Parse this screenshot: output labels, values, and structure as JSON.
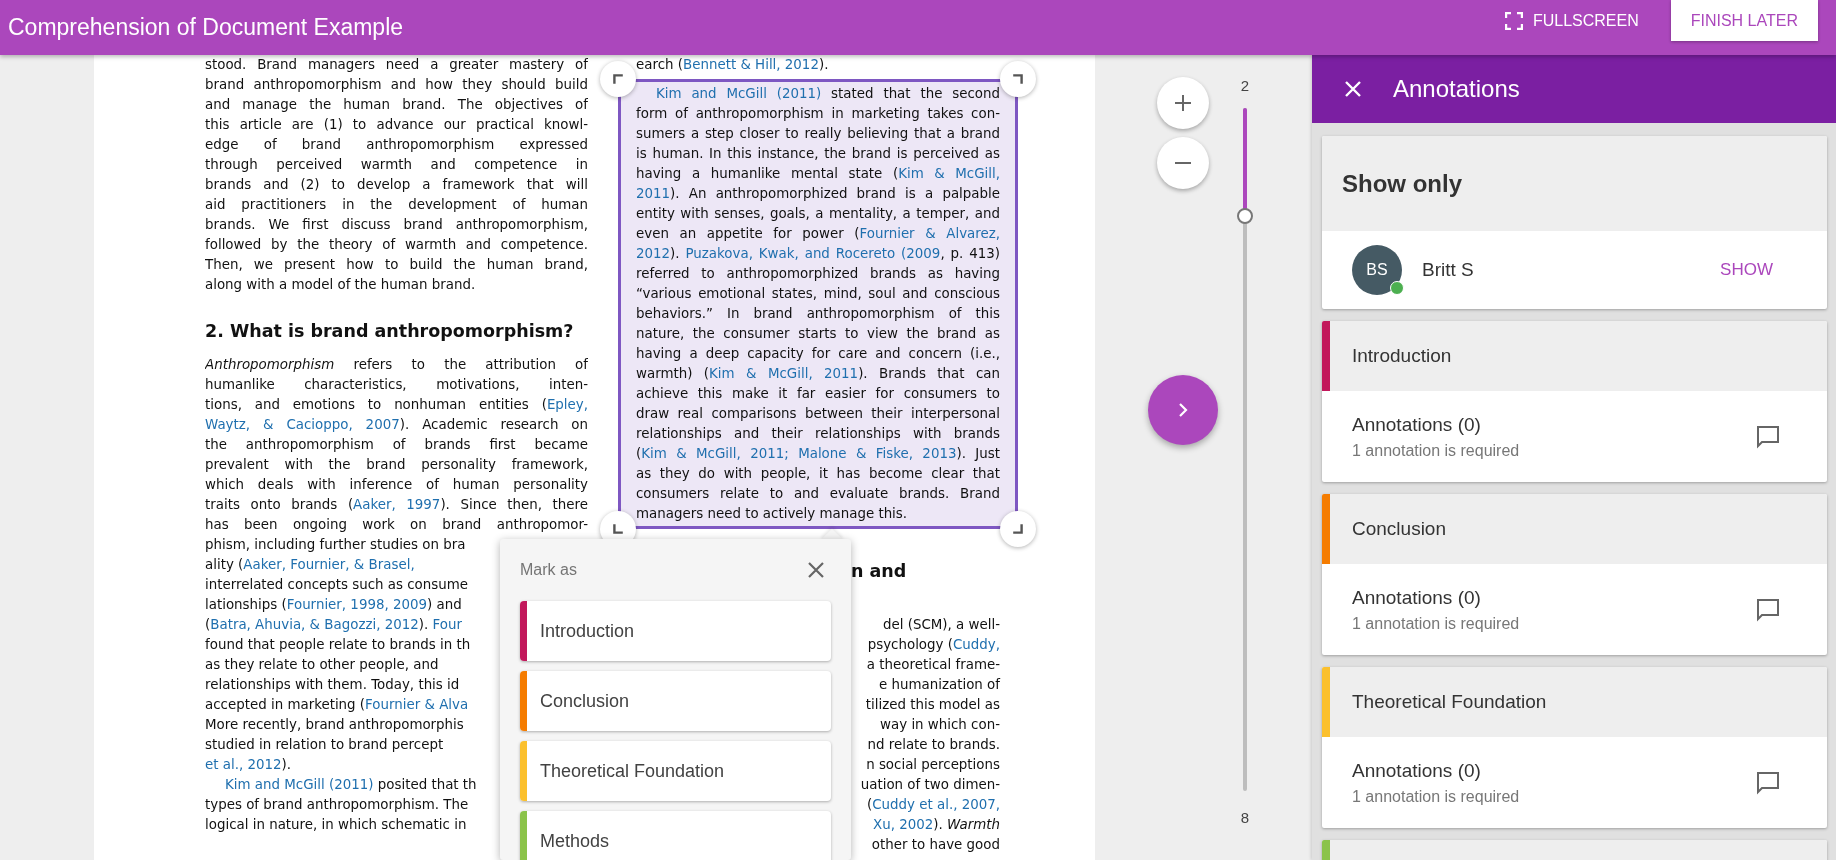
{
  "app_bar": {
    "title": "Comprehension of Document Example",
    "fullscreen_label": "FULLSCREEN",
    "finish_label": "FINISH LATER"
  },
  "document": {
    "columns": [
      {
        "blocks": [
          {
            "kind": "para",
            "lines": [
              {
                "kind": "justify",
                "parts": [
                  {
                    "text": "stood. Brand managers need a greater mastery of"
                  }
                ]
              },
              {
                "kind": "justify",
                "parts": [
                  {
                    "text": "brand anthropomorphism and how they should build"
                  }
                ]
              },
              {
                "kind": "justify",
                "parts": [
                  {
                    "text": "and manage the human brand. The objectives of"
                  }
                ]
              },
              {
                "kind": "justify",
                "parts": [
                  {
                    "text": "this article are (1) to advance our practical knowl-"
                  }
                ]
              },
              {
                "kind": "justify",
                "parts": [
                  {
                    "text": "edge of brand anthropomorphism expressed"
                  }
                ]
              },
              {
                "kind": "justify",
                "parts": [
                  {
                    "text": "through perceived warmth and competence in"
                  }
                ]
              },
              {
                "kind": "justify",
                "parts": [
                  {
                    "text": "brands and (2) to develop a framework that will"
                  }
                ]
              },
              {
                "kind": "justify",
                "parts": [
                  {
                    "text": "aid practitioners in the development of human"
                  }
                ]
              },
              {
                "kind": "justify",
                "parts": [
                  {
                    "text": "brands. We first discuss brand anthropomorphism,"
                  }
                ]
              },
              {
                "kind": "justify",
                "parts": [
                  {
                    "text": "followed by the theory of warmth and competence."
                  }
                ]
              },
              {
                "kind": "justify",
                "parts": [
                  {
                    "text": "Then, we present how to build the human brand,"
                  }
                ]
              },
              {
                "kind": "left",
                "parts": [
                  {
                    "text": "along with a model of the human brand."
                  }
                ]
              }
            ]
          },
          {
            "kind": "heading",
            "lines": [
              {
                "kind": "left",
                "parts": [
                  {
                    "text": "2.  What is brand anthropomorphism?"
                  }
                ]
              }
            ]
          },
          {
            "kind": "para",
            "lines": [
              {
                "kind": "justify",
                "parts": [
                  {
                    "text": "*Anthropomorphism* refers to the attribution of"
                  }
                ]
              },
              {
                "kind": "justify",
                "parts": [
                  {
                    "text": "humanlike characteristics, motivations, inten-"
                  }
                ]
              },
              {
                "kind": "justify",
                "parts": [
                  {
                    "text": "tions, and emotions to nonhuman entities ("
                  },
                  {
                    "text": "Epley,",
                    "cite": true
                  }
                ]
              },
              {
                "kind": "justify",
                "parts": [
                  {
                    "text": "Waytz, & Cacioppo, 2007",
                    "cite": true
                  },
                  {
                    "text": "). Academic research on"
                  }
                ]
              },
              {
                "kind": "justify",
                "parts": [
                  {
                    "text": "the anthropomorphism of brands first became"
                  }
                ]
              },
              {
                "kind": "justify",
                "parts": [
                  {
                    "text": "prevalent with the brand personality framework,"
                  }
                ]
              },
              {
                "kind": "justify",
                "parts": [
                  {
                    "text": "which deals with inference of human personality"
                  }
                ]
              },
              {
                "kind": "justify",
                "parts": [
                  {
                    "text": "traits onto brands ("
                  },
                  {
                    "text": "Aaker, 1997",
                    "cite": true
                  },
                  {
                    "text": "). Since then, there"
                  }
                ]
              },
              {
                "kind": "justify",
                "parts": [
                  {
                    "text": "has been ongoing work on brand anthropomor-"
                  }
                ]
              },
              {
                "kind": "left",
                "parts": [
                  {
                    "text": "phism, including further studies on bra"
                  }
                ]
              },
              {
                "kind": "left",
                "parts": [
                  {
                    "text": "ality ("
                  },
                  {
                    "text": "Aaker, Fournier, & Brasel,",
                    "cite": true
                  }
                ]
              },
              {
                "kind": "left",
                "parts": [
                  {
                    "text": "interrelated concepts such as consume"
                  }
                ]
              },
              {
                "kind": "left",
                "parts": [
                  {
                    "text": "lationships ("
                  },
                  {
                    "text": "Fournier, 1998, 2009",
                    "cite": true
                  },
                  {
                    "text": ") and"
                  }
                ]
              },
              {
                "kind": "left",
                "parts": [
                  {
                    "text": "("
                  },
                  {
                    "text": "Batra, Ahuvia, & Bagozzi, 2012",
                    "cite": true
                  },
                  {
                    "text": "). "
                  },
                  {
                    "text": "Four",
                    "cite": true
                  }
                ]
              },
              {
                "kind": "left",
                "parts": [
                  {
                    "text": "found that people relate to brands in th"
                  }
                ]
              },
              {
                "kind": "left",
                "parts": [
                  {
                    "text": "as they relate to other people, and"
                  }
                ]
              },
              {
                "kind": "left",
                "parts": [
                  {
                    "text": "relationships with them. Today, this id"
                  }
                ]
              },
              {
                "kind": "left",
                "parts": [
                  {
                    "text": "accepted in marketing ("
                  },
                  {
                    "text": "Fournier & Alva",
                    "cite": true
                  }
                ]
              },
              {
                "kind": "left",
                "parts": [
                  {
                    "text": "More recently, brand anthropomorphis"
                  }
                ]
              },
              {
                "kind": "left",
                "parts": [
                  {
                    "text": "studied in relation to brand percept"
                  }
                ]
              },
              {
                "kind": "left",
                "parts": [
                  {
                    "text": "et al., 2012",
                    "cite": true
                  },
                  {
                    "text": ")."
                  }
                ]
              },
              {
                "kind": "indent",
                "parts": [
                  {
                    "text": "Kim and McGill (2011)",
                    "cite": true
                  },
                  {
                    "text": " posited that th"
                  }
                ]
              },
              {
                "kind": "left",
                "parts": [
                  {
                    "text": "types of brand anthropomorphism. The"
                  }
                ]
              },
              {
                "kind": "left",
                "parts": [
                  {
                    "text": "logical in nature, in which schematic in"
                  }
                ]
              }
            ]
          }
        ]
      },
      {
        "blocks": [
          {
            "kind": "para",
            "lines": [
              {
                "kind": "left",
                "parts": [
                  {
                    "text": "earch ("
                  },
                  {
                    "text": "Bennett & Hill, 2012",
                    "cite": true
                  },
                  {
                    "text": ")."
                  }
                ]
              }
            ]
          },
          {
            "kind": "selection",
            "lines": [
              {
                "kind": "indent-justify",
                "parts": [
                  {
                    "text": "Kim and McGill (2011)",
                    "cite": true
                  },
                  {
                    "text": " stated that the second"
                  }
                ]
              },
              {
                "kind": "justify",
                "parts": [
                  {
                    "text": "form of anthropomorphism in marketing takes con-"
                  }
                ]
              },
              {
                "kind": "justify",
                "parts": [
                  {
                    "text": "sumers a step closer to really believing that a brand"
                  }
                ]
              },
              {
                "kind": "justify",
                "parts": [
                  {
                    "text": "is human. In this instance, the brand is perceived as"
                  }
                ]
              },
              {
                "kind": "justify",
                "parts": [
                  {
                    "text": "having a humanlike mental state ("
                  },
                  {
                    "text": "Kim & McGill,",
                    "cite": true
                  }
                ]
              },
              {
                "kind": "justify",
                "parts": [
                  {
                    "text": "2011",
                    "cite": true
                  },
                  {
                    "text": "). An anthropomorphized brand is a palpable"
                  }
                ]
              },
              {
                "kind": "justify",
                "parts": [
                  {
                    "text": "entity with senses, goals, a mentality, a temper, and"
                  }
                ]
              },
              {
                "kind": "justify",
                "parts": [
                  {
                    "text": "even an appetite for power ("
                  },
                  {
                    "text": "Fournier & Alvarez,",
                    "cite": true
                  }
                ]
              },
              {
                "kind": "justify",
                "parts": [
                  {
                    "text": "2012",
                    "cite": true
                  },
                  {
                    "text": "). "
                  },
                  {
                    "text": "Puzakova, Kwak, and Rocereto (2009",
                    "cite": true
                  },
                  {
                    "text": ", p. 413)"
                  }
                ]
              },
              {
                "kind": "justify",
                "parts": [
                  {
                    "text": "referred to anthropomorphized brands as having"
                  }
                ]
              },
              {
                "kind": "justify",
                "parts": [
                  {
                    "text": "“various emotional states, mind, soul and conscious"
                  }
                ]
              },
              {
                "kind": "justify",
                "parts": [
                  {
                    "text": "behaviors.” In brand anthropomorphism of this"
                  }
                ]
              },
              {
                "kind": "justify",
                "parts": [
                  {
                    "text": "nature, the consumer starts to view the brand as"
                  }
                ]
              },
              {
                "kind": "justify",
                "parts": [
                  {
                    "text": "having a deep capacity for care and concern (i.e.,"
                  }
                ]
              },
              {
                "kind": "justify",
                "parts": [
                  {
                    "text": "warmth) ("
                  },
                  {
                    "text": "Kim & McGill, 2011",
                    "cite": true
                  },
                  {
                    "text": "). Brands that can"
                  }
                ]
              },
              {
                "kind": "justify",
                "parts": [
                  {
                    "text": "achieve this make it far easier for consumers to"
                  }
                ]
              },
              {
                "kind": "justify",
                "parts": [
                  {
                    "text": "draw real comparisons between their interpersonal"
                  }
                ]
              },
              {
                "kind": "justify",
                "parts": [
                  {
                    "text": "relationships and their relationships with brands"
                  }
                ]
              },
              {
                "kind": "justify",
                "parts": [
                  {
                    "text": "("
                  },
                  {
                    "text": "Kim & McGill, 2011; Malone & Fiske, 2013",
                    "cite": true
                  },
                  {
                    "text": "). Just"
                  }
                ]
              },
              {
                "kind": "justify",
                "parts": [
                  {
                    "text": "as they do with people, it has become clear that"
                  }
                ]
              },
              {
                "kind": "justify",
                "parts": [
                  {
                    "text": "consumers relate to and evaluate brands. Brand"
                  }
                ]
              },
              {
                "kind": "left",
                "parts": [
                  {
                    "text": "managers need to actively manage this."
                  }
                ]
              }
            ]
          },
          {
            "kind": "heading",
            "lines": [
              {
                "kind": "after-popup",
                "parts": [
                  {
                    "text": "n and"
                  }
                ]
              }
            ]
          },
          {
            "kind": "para",
            "lines": [
              {
                "kind": "right",
                "parts": [
                  {
                    "text": "del (SCM), a well-"
                  }
                ]
              },
              {
                "kind": "right",
                "parts": [
                  {
                    "text": "psychology ("
                  },
                  {
                    "text": "Cuddy,",
                    "cite": true
                  }
                ]
              },
              {
                "kind": "right",
                "parts": [
                  {
                    "text": "a theoretical frame-"
                  }
                ]
              },
              {
                "kind": "right",
                "parts": [
                  {
                    "text": "e humanization of"
                  }
                ]
              },
              {
                "kind": "right",
                "parts": [
                  {
                    "text": "tilized this model as"
                  }
                ]
              },
              {
                "kind": "right",
                "parts": [
                  {
                    "text": "way in which con-"
                  }
                ]
              },
              {
                "kind": "right",
                "parts": [
                  {
                    "text": "nd relate to brands."
                  }
                ]
              },
              {
                "kind": "right",
                "parts": [
                  {
                    "text": "n social perceptions"
                  }
                ]
              },
              {
                "kind": "right",
                "parts": [
                  {
                    "text": "uation of two dimen-"
                  }
                ]
              },
              {
                "kind": "right",
                "parts": [
                  {
                    "text": "("
                  },
                  {
                    "text": "Cuddy et al., 2007,",
                    "cite": true
                  }
                ]
              },
              {
                "kind": "right",
                "parts": [
                  {
                    "text": "Xu, 2002",
                    "cite": true
                  },
                  {
                    "text": "). *Warmth*"
                  }
                ]
              },
              {
                "kind": "right",
                "parts": [
                  {
                    "text": "other to have good"
                  }
                ]
              }
            ]
          }
        ]
      }
    ]
  },
  "mark_as_popup": {
    "title": "Mark as",
    "options": [
      {
        "label": "Introduction",
        "color": "#c2185b"
      },
      {
        "label": "Conclusion",
        "color": "#f57c00"
      },
      {
        "label": "Theoretical Foundation",
        "color": "#fbc02d"
      },
      {
        "label": "Methods",
        "color": "#8bc34a"
      }
    ]
  },
  "zoom_slider": {
    "top_label": "2",
    "bottom_label": "8",
    "level": 0.16
  },
  "annotations_panel": {
    "title": "Annotations",
    "show_only": {
      "title": "Show only",
      "user": {
        "initials": "BS",
        "name": "Britt S",
        "online": true,
        "action": "SHOW"
      }
    },
    "sections": [
      {
        "title": "Introduction",
        "color": "#c2185b",
        "count": "Annotations (0)",
        "note": "1 annotation is required"
      },
      {
        "title": "Conclusion",
        "color": "#f57c00",
        "count": "Annotations (0)",
        "note": "1 annotation is required"
      },
      {
        "title": "Theoretical Foundation",
        "color": "#fbc02d",
        "count": "Annotations (0)",
        "note": "1 annotation is required"
      },
      {
        "color": "#8bc34a"
      }
    ]
  }
}
